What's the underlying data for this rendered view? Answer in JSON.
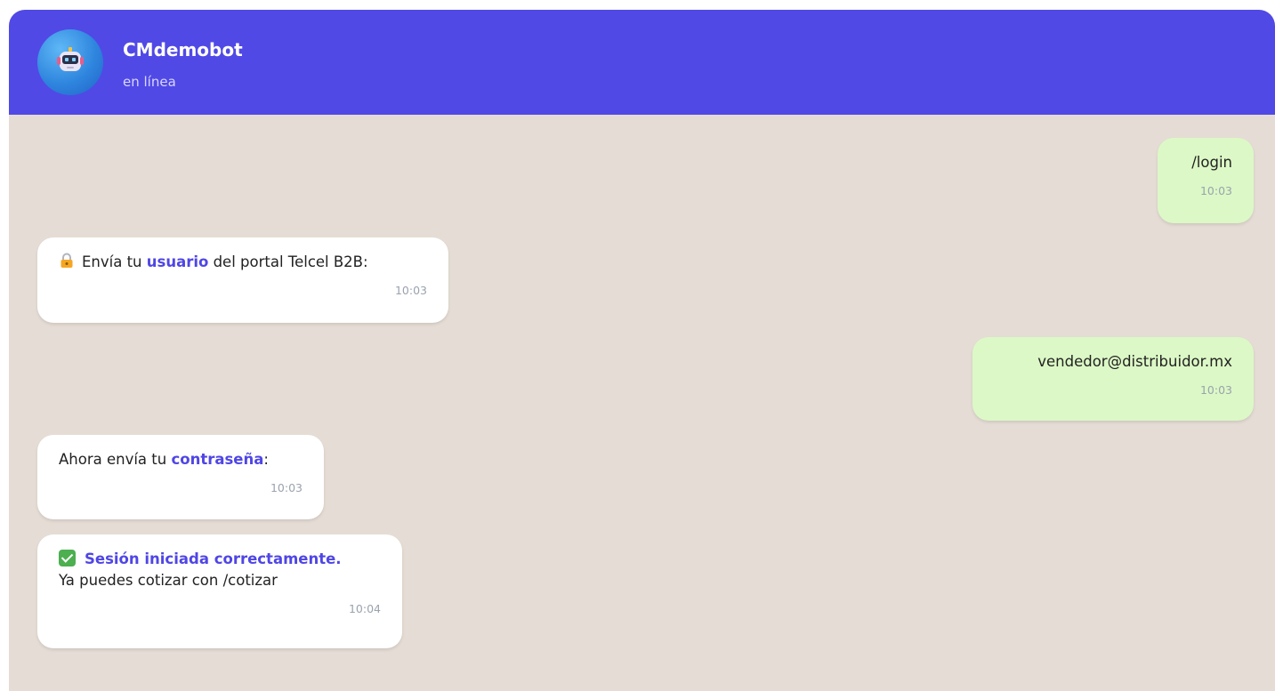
{
  "header": {
    "bot_name": "CMdemobot",
    "status": "en línea",
    "avatar_icon": "robot-icon",
    "color": "#5049e6"
  },
  "messages": [
    {
      "from": "user",
      "text": "/login",
      "time": "10:03"
    },
    {
      "from": "bot",
      "icon": "lock-icon",
      "parts": [
        "Envía tu ",
        "usuario",
        " del portal Telcel B2B:"
      ],
      "time": "10:03"
    },
    {
      "from": "user",
      "text": "vendedor@distribuidor.mx",
      "time": "10:03"
    },
    {
      "from": "bot",
      "parts": [
        "Ahora envía tu ",
        "contraseña",
        ":"
      ],
      "time": "10:03"
    },
    {
      "from": "bot",
      "icon": "checkmark-icon",
      "headline": "Sesión iniciada correctamente.",
      "text": "Ya puedes cotizar con /cotizar",
      "time": "10:04"
    }
  ],
  "colors": {
    "accent": "#4f46e5",
    "chat_bg": "#e5ddd5",
    "user_bubble": "#dcf8c6",
    "bot_bubble": "#ffffff"
  }
}
